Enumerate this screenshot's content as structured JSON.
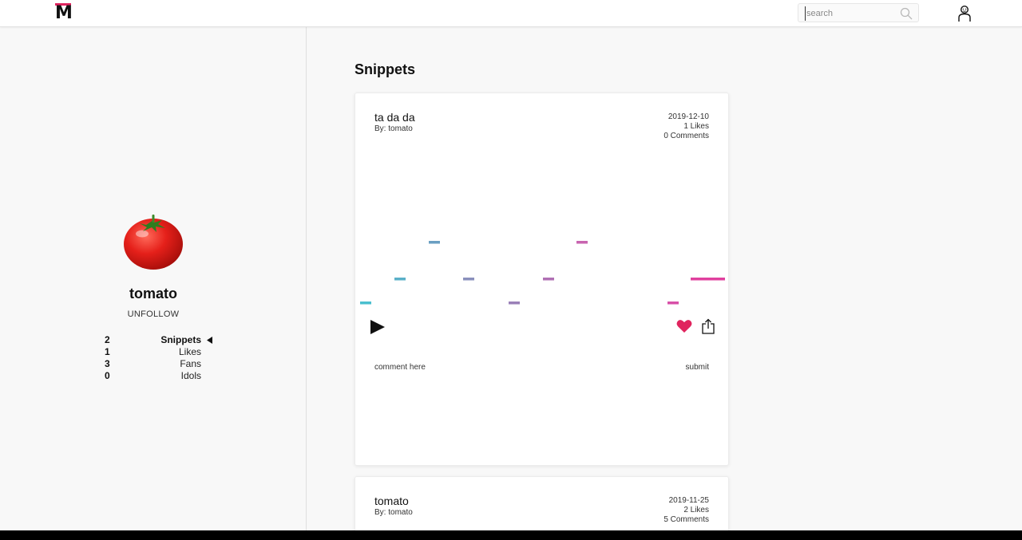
{
  "app": {
    "logo_letter": "M",
    "accent_color": "#e0245e"
  },
  "header": {
    "search": {
      "placeholder": "search",
      "value": ""
    }
  },
  "profile": {
    "username": "tomato",
    "unfollow_label": "UNFOLLOW",
    "stats": [
      {
        "count": "2",
        "label": "Snippets",
        "active": true
      },
      {
        "count": "1",
        "label": "Likes"
      },
      {
        "count": "3",
        "label": "Fans"
      },
      {
        "count": "0",
        "label": "Idols"
      }
    ]
  },
  "main": {
    "title": "Snippets",
    "snippets": [
      {
        "title": "ta da da",
        "by": "By: tomato",
        "date": "2019-12-10",
        "likes": "1 Likes",
        "comments": "0 Comments",
        "liked": true,
        "comment_placeholder": "comment here",
        "submit_label": "submit",
        "note_colors": [
          "#4bbfcf",
          "#5ab0c8",
          "#6a9fc2",
          "#8a90bc",
          "#9a80b8",
          "#b070b4",
          "#c865b0",
          "#d850a8",
          "#e0409e"
        ]
      },
      {
        "title": "tomato",
        "by": "By: tomato",
        "date": "2019-11-25",
        "likes": "2 Likes",
        "comments": "5 Comments"
      }
    ]
  }
}
